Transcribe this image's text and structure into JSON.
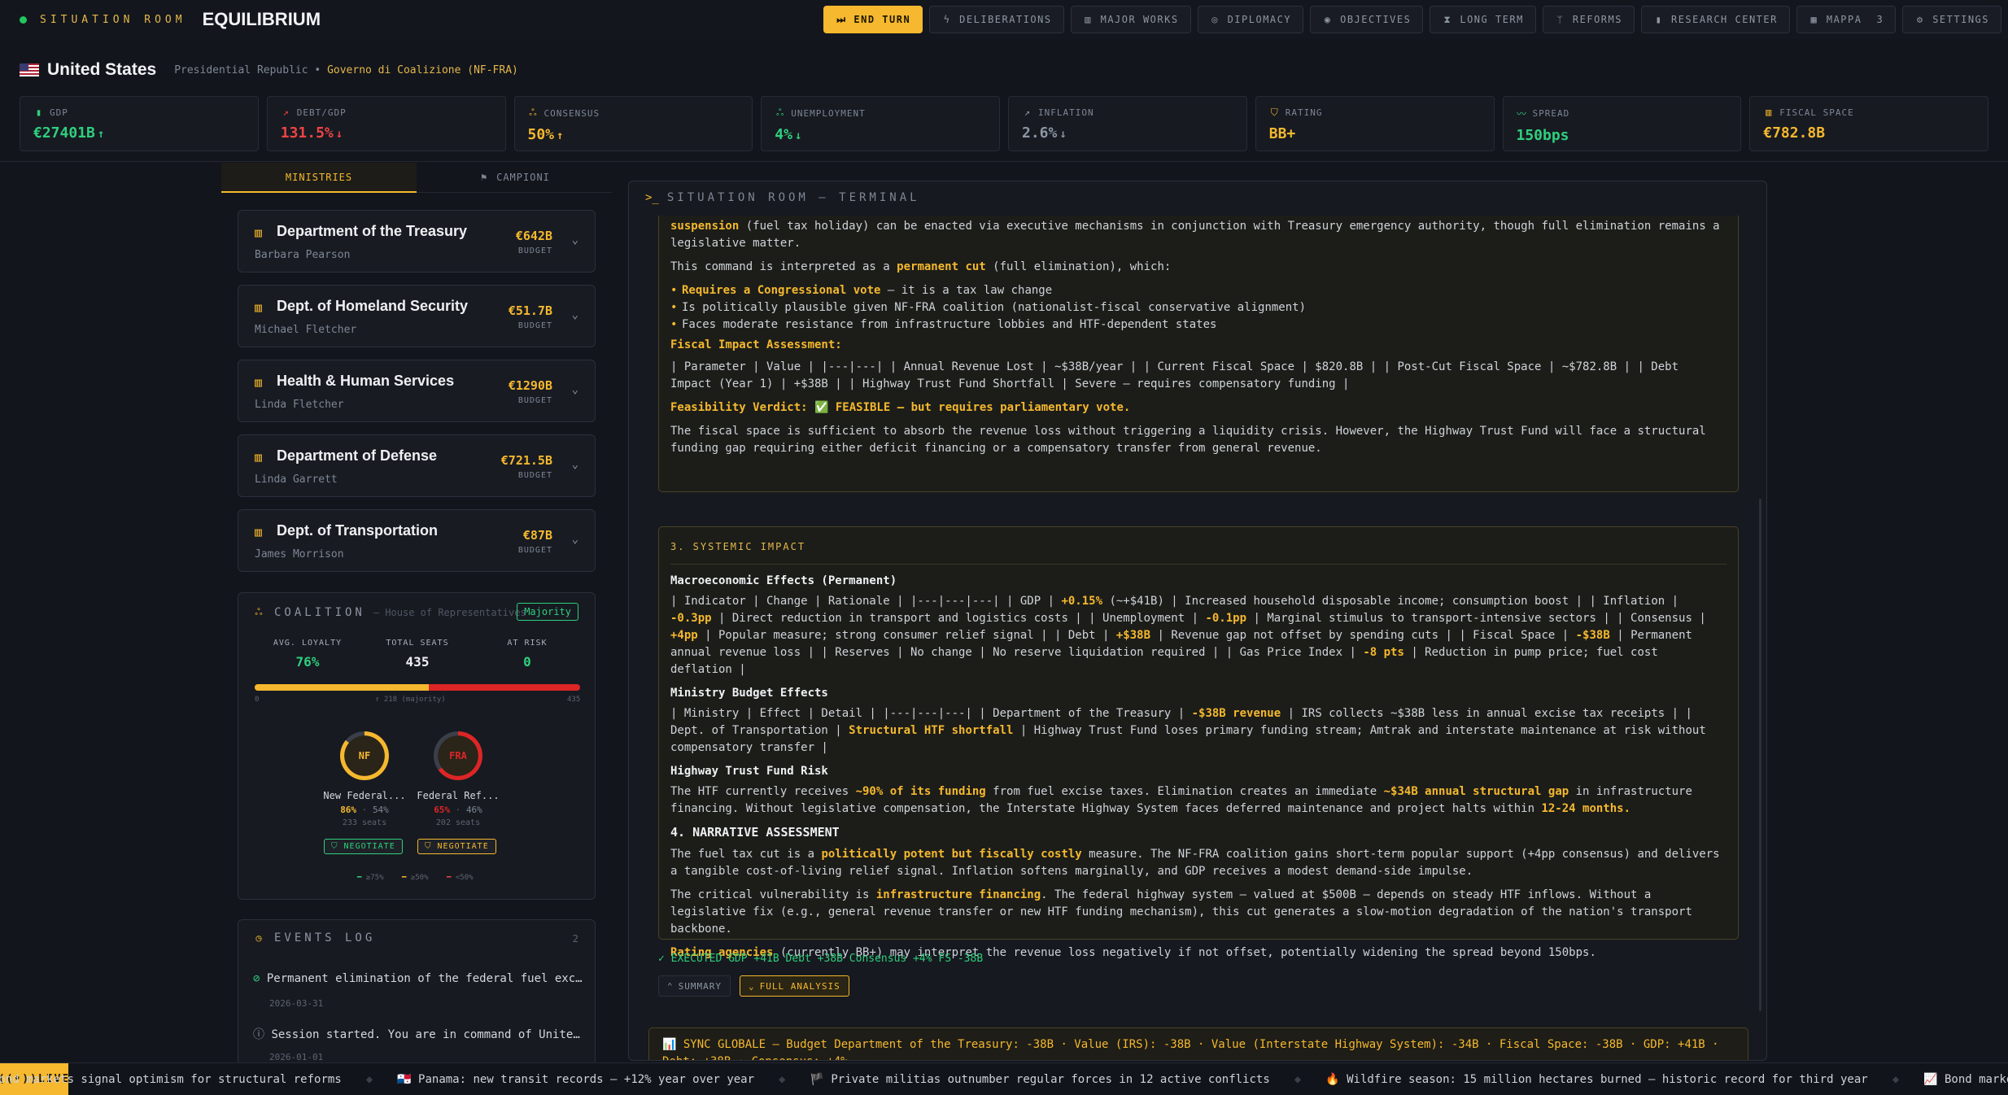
{
  "header": {
    "brand_sub": "SITUATION ROOM",
    "brand_title": "EQUILIBRIUM",
    "nav": [
      {
        "label": "END TURN",
        "icon": "play-icon",
        "glyph": "⏭"
      },
      {
        "label": "DELIBERATIONS",
        "icon": "bolt-icon",
        "glyph": "ϟ"
      },
      {
        "label": "MAJOR WORKS",
        "icon": "building-icon",
        "glyph": "▥"
      },
      {
        "label": "DIPLOMACY",
        "icon": "globe-icon",
        "glyph": "◎"
      },
      {
        "label": "OBJECTIVES",
        "icon": "target-icon",
        "glyph": "◉"
      },
      {
        "label": "LONG TERM",
        "icon": "hourglass-icon",
        "glyph": "⧗"
      },
      {
        "label": "REFORMS",
        "icon": "git-branch-icon",
        "glyph": "ᛘ"
      },
      {
        "label": "RESEARCH CENTER",
        "icon": "bar-chart-icon",
        "glyph": "▮"
      },
      {
        "label": "MAPPA",
        "icon": "map-icon",
        "glyph": "▦"
      },
      {
        "label": "SETTINGS",
        "icon": "gear-icon",
        "glyph": "⚙"
      }
    ],
    "mappa_badge": "3"
  },
  "country": {
    "name": "United States",
    "system": "Presidential Republic",
    "separator": "•",
    "government": "Governo di Coalizione (NF-FRA)"
  },
  "stats": [
    {
      "label": "GDP",
      "value": "€27401B",
      "trend": "↑",
      "color": "#2fcf7e",
      "icon": "chart-icon",
      "glyph": "▮"
    },
    {
      "label": "DEBT/GDP",
      "value": "131.5%",
      "trend": "↓",
      "color": "#ef4444",
      "icon": "trend-icon",
      "glyph": "↗"
    },
    {
      "label": "CONSENSUS",
      "value": "50%",
      "trend": "↑",
      "color": "#f5b82e",
      "icon": "users-icon",
      "glyph": "ஃ"
    },
    {
      "label": "UNEMPLOYMENT",
      "value": "4%",
      "trend": "↓",
      "color": "#2fcf7e",
      "icon": "user-icon",
      "glyph": "ஃ"
    },
    {
      "label": "INFLATION",
      "value": "2.6%",
      "trend": "↓",
      "color": "#8e96a3",
      "icon": "trend-icon",
      "glyph": "↗"
    },
    {
      "label": "RATING",
      "value": "BB+",
      "trend": "",
      "color": "#f5b82e",
      "icon": "shield-icon",
      "glyph": "⛉"
    },
    {
      "label": "SPREAD",
      "value": "150bps",
      "trend": "",
      "color": "#2fcf7e",
      "icon": "activity-icon",
      "glyph": "〰"
    },
    {
      "label": "FISCAL SPACE",
      "value": "€782.8B",
      "trend": "",
      "color": "#f5b82e",
      "icon": "bank-icon",
      "glyph": "▥"
    }
  ],
  "left_tabs": {
    "ministries": "MINISTRIES",
    "champions": "CAMPIONI"
  },
  "ministries": [
    {
      "name": "Department of the Treasury",
      "person": "Barbara Pearson",
      "budget": "€642B"
    },
    {
      "name": "Dept. of Homeland Security",
      "person": "Michael Fletcher",
      "budget": "€51.7B"
    },
    {
      "name": "Health & Human Services",
      "person": "Linda Fletcher",
      "budget": "€1290B"
    },
    {
      "name": "Department of Defense",
      "person": "Linda Garrett",
      "budget": "€721.5B"
    },
    {
      "name": "Dept. of Transportation",
      "person": "James Morrison",
      "budget": "€87B"
    }
  ],
  "budget_label": "BUDGET",
  "coalition": {
    "title": "COALITION",
    "subtitle": "— House of Representatives",
    "badge": "Majority",
    "avg_loyalty_label": "AVG. LOYALTY",
    "avg_loyalty": "76%",
    "total_seats_label": "TOTAL SEATS",
    "total_seats": "435",
    "at_risk_label": "AT RISK",
    "at_risk": "0",
    "coalition_share": 0.535,
    "bar_min": "0",
    "bar_mid": "↑ 218 (majority)",
    "bar_max": "435",
    "parties": [
      {
        "abbr": "NF",
        "name": "New Federal...",
        "loyalty": "86%",
        "share": "54%",
        "seats": "233 seats",
        "color": "#f5b82e",
        "ring": 0.86,
        "negotiate": "NEGOTIATE",
        "neg_color": "#2fcf7e"
      },
      {
        "abbr": "FRA",
        "name": "Federal Ref...",
        "loyalty": "65%",
        "share": "46%",
        "seats": "202 seats",
        "color": "#dc2626",
        "ring": 0.65,
        "negotiate": "NEGOTIATE",
        "neg_color": "#f5b82e"
      }
    ],
    "legend": [
      {
        "label": "≥75%",
        "color": "#2fcf7e"
      },
      {
        "label": "≥50%",
        "color": "#f5b82e"
      },
      {
        "label": "<50%",
        "color": "#ef4444"
      }
    ]
  },
  "events": {
    "title": "EVENTS LOG",
    "count": "2",
    "items": [
      {
        "text": "Permanent elimination of the federal fuel excise tax",
        "date": "2026-03-31"
      },
      {
        "text": "Session started. You are in command of United States",
        "date": "2026-01-01"
      }
    ]
  },
  "terminal": {
    "prompt": ">_",
    "title": "SITUATION ROOM — TERMINAL",
    "box1": {
      "intro_a": "suspension",
      "intro_b": " (fuel tax holiday) can be enacted via executive mechanisms in conjunction with Treasury emergency authority, though full elimination remains a legislative matter.",
      "interp_a": "This command is interpreted as a ",
      "interp_b": "permanent cut",
      "interp_c": " (full elimination), which:",
      "b1_a": "Requires a Congressional vote",
      "b1_b": " — it is a tax law change",
      "b2": "Is politically plausible given NF-FRA coalition (nationalist-fiscal conservative alignment)",
      "b3": "Faces moderate resistance from infrastructure lobbies and HTF-dependent states",
      "fiscal_head": "Fiscal Impact Assessment:",
      "fiscal_table": "| Parameter | Value | |---|---| | Annual Revenue Lost | ~$38B/year | | Current Fiscal Space | $820.8B | | Post-Cut Fiscal Space | ~$782.8B | | Debt Impact (Year 1) | +$38B | | Highway Trust Fund Shortfall | Severe — requires compensatory funding |",
      "verdict": "Feasibility Verdict: ✅ FEASIBLE — but requires parliamentary vote.",
      "closing": "The fiscal space is sufficient to absorb the revenue loss without triggering a liquidity crisis. However, the Highway Trust Fund will face a structural funding gap requiring either deficit financing or a compensatory transfer from general revenue."
    },
    "box2": {
      "section": "3. SYSTEMIC IMPACT",
      "macro_head": "Macroeconomic Effects (Permanent)",
      "macro_1": "| Indicator | Change | Rationale | |---|---|---| | GDP | ",
      "macro_gdp": "+0.15%",
      "macro_2": " (~+$41B) | Increased household disposable income; consumption boost | | Inflation | ",
      "macro_inf": "-0.3pp",
      "macro_3": " | Direct reduction in transport and logistics costs | | Unemployment | ",
      "macro_unemp": "-0.1pp",
      "macro_4": " | Marginal stimulus to transport-intensive sectors | | Consensus | ",
      "macro_cons": "+4pp",
      "macro_5": " | Popular measure; strong consumer relief signal | | Debt | ",
      "macro_debt": "+$38B",
      "macro_6": " | Revenue gap not offset by spending cuts | | Fiscal Space | ",
      "macro_fs": "-$38B",
      "macro_7": " | Permanent annual revenue loss | | Reserves | No change | No reserve liquidation required | | Gas Price Index | ",
      "macro_gas": "-8 pts",
      "macro_8": " | Reduction in pump price; fuel cost deflation |",
      "min_head": "Ministry Budget Effects",
      "min_1": "| Ministry | Effect | Detail | |---|---|---| | Department of the Treasury | ",
      "min_eff1": "-$38B revenue",
      "min_2": " | IRS collects ~$38B less in annual excise tax receipts | | Dept. of Transportation | ",
      "min_eff2": "Structural HTF shortfall",
      "min_3": " | Highway Trust Fund loses primary funding stream; Amtrak and interstate maintenance at risk without compensatory transfer |",
      "htf_head": "Highway Trust Fund Risk",
      "htf_1": "The HTF currently receives ",
      "htf_hl1": "~90% of its funding",
      "htf_2": " from fuel excise taxes. Elimination creates an immediate ",
      "htf_hl2": "~$34B annual structural gap",
      "htf_3": " in infrastructure financing. Without legislative compensation, the Interstate Highway System faces deferred maintenance and project halts within ",
      "htf_hl3": "12-24 months.",
      "narr_head": "4. NARRATIVE ASSESSMENT",
      "narr1_a": "The fuel tax cut is a ",
      "narr1_hl": "politically potent but fiscally costly",
      "narr1_b": " measure. The NF-FRA coalition gains short-term popular support (+4pp consensus) and delivers a tangible cost-of-living relief signal. Inflation softens marginally, and GDP receives a modest demand-side impulse.",
      "narr2_a": "The critical vulnerability is ",
      "narr2_hl": "infrastructure financing",
      "narr2_b": ". The federal highway system — valued at $500B — depends on steady HTF inflows. Without a legislative fix (e.g., general revenue transfer or new HTF funding mechanism), this cut generates a slow-motion degradation of the nation's transport backbone.",
      "narr3_hl": "Rating agencies",
      "narr3_b": " (currently BB+) may interpret the revenue loss negatively if not offset, potentially widening the spread beyond 150bps."
    },
    "executed": "✓ EXECUTED   GDP +41B   Debt +38B   Consensus +4%   FS -38B",
    "summary_btn": "SUMMARY",
    "full_btn": "FULL ANALYSIS",
    "sync": "📊 SYNC GLOBALE — Budget Department of the Treasury: -38B · Value (IRS): -38B · Value (Interstate Highway System): -34B · Fiscal Space: -38B · GDP: +41B · Debt: +38B · Consensus: +4%"
  },
  "ticker": {
    "live": "LIVE",
    "items": [
      "📈 Bond markets signal optimism for structural reforms",
      "🇵🇦 Panama: new transit records — +12% year over year",
      "🏴 Private militias outnumber regular forces in 12 active conflicts",
      "🔥 Wildfire season: 15 million hectares burned — historic record for third year",
      "📈 Bond markets signal optimism"
    ]
  }
}
